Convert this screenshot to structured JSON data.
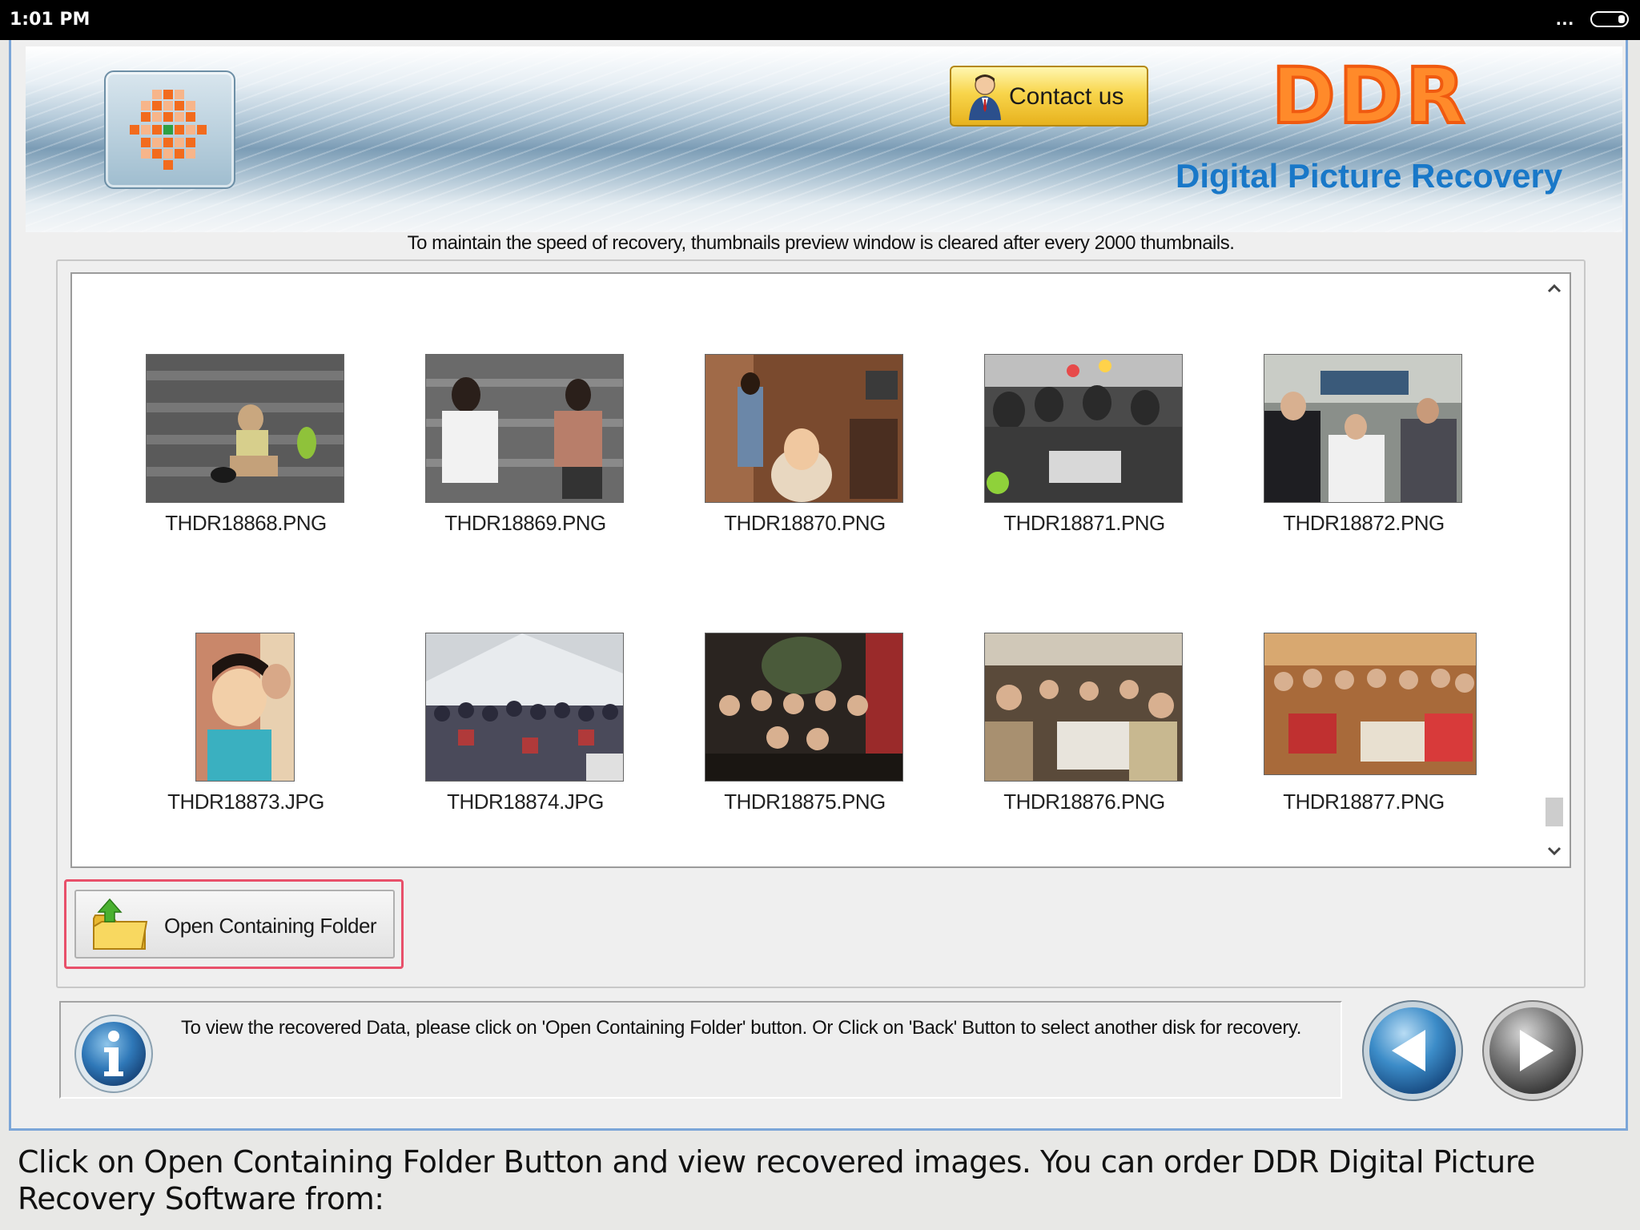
{
  "statusbar": {
    "time": "1:01 PM",
    "menu": "..."
  },
  "app": {
    "brand": "DDR",
    "subtitle": "Digital Picture Recovery",
    "contact_label": "Contact us"
  },
  "notice": "To maintain the speed of recovery, thumbnails preview window is cleared after every 2000 thumbnails.",
  "thumbnails": [
    {
      "file": "THDR18868.PNG"
    },
    {
      "file": "THDR18869.PNG"
    },
    {
      "file": "THDR18870.PNG"
    },
    {
      "file": "THDR18871.PNG"
    },
    {
      "file": "THDR18872.PNG"
    },
    {
      "file": "THDR18873.JPG"
    },
    {
      "file": "THDR18874.JPG"
    },
    {
      "file": "THDR18875.PNG"
    },
    {
      "file": "THDR18876.PNG"
    },
    {
      "file": "THDR18877.PNG"
    }
  ],
  "open_folder_label": "Open Containing Folder",
  "info_text": "To view the recovered Data, please click on 'Open Containing Folder' button. Or Click on 'Back' Button to select another disk for recovery.",
  "caption": "Click on Open Containing Folder Button and view recovered images. You can order DDR Digital Picture Recovery Software from:",
  "colors": {
    "brand_orange": "#ff8a2a",
    "subtitle_blue": "#1978c8",
    "highlight_red": "#e8506a",
    "window_border": "#7ca6d8"
  }
}
